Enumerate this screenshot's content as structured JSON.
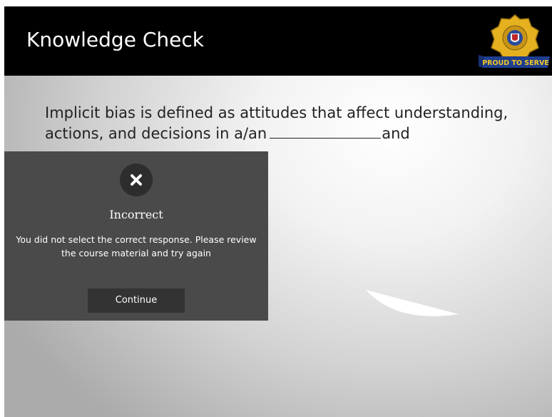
{
  "header": {
    "title": "Knowledge Check",
    "badge": {
      "ribbon_text": "PROUD TO SERVE",
      "icon": "police-badge-icon"
    }
  },
  "question": {
    "line1": "Implicit bias is defined as attitudes that affect understanding,",
    "line2_start": "actions, and decisions in a/an",
    "line2_end": "and"
  },
  "feedback": {
    "icon": "close-icon",
    "title": "Incorrect",
    "message": "You did not select the correct response. Please review the course material and try again",
    "continue_label": "Continue"
  },
  "colors": {
    "header_bg": "#000000",
    "panel_bg": "#4a4a4a",
    "button_bg": "#333333",
    "badge_gold": "#e6b121",
    "ribbon_blue": "#1e3f8f"
  }
}
